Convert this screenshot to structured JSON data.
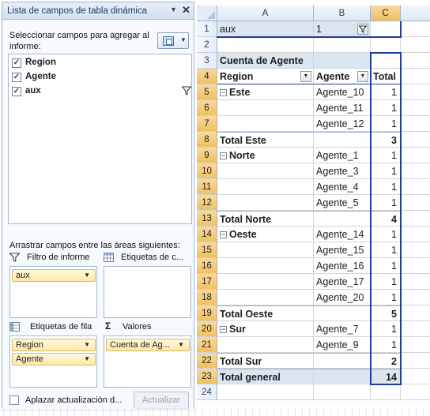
{
  "pane": {
    "title": "Lista de campos de tabla dinámica",
    "close_glyph": "✕",
    "dropdown_glyph": "▼",
    "choose_label": "Seleccionar campos para agregar al informe:",
    "layout_icon": "field-list-layout-icon",
    "fields": [
      {
        "label": "Region",
        "checked": true
      },
      {
        "label": "Agente",
        "checked": true
      },
      {
        "label": "aux",
        "checked": true
      }
    ],
    "drag_label": "Arrastrar campos entre las áreas siguientes:",
    "areas": {
      "filter": {
        "label": "Filtro de informe",
        "items": [
          "aux"
        ]
      },
      "columns": {
        "label": "Etiquetas de c...",
        "items": []
      },
      "rows": {
        "label": "Etiquetas de fila",
        "items": [
          "Region",
          "Agente"
        ]
      },
      "values": {
        "label": "Valores",
        "items": [
          "Cuenta de Ag..."
        ]
      }
    },
    "values_symbol": "Σ",
    "defer_label": "Aplazar actualización d...",
    "update_button": "Actualizar",
    "colors": {
      "pill": "#fde9a8",
      "accent": "#1f3d9b"
    }
  },
  "sheet": {
    "columns": [
      "A",
      "B",
      "C"
    ],
    "rows": [
      {
        "n": "1",
        "a": "aux",
        "b": "1",
        "c": ""
      },
      {
        "n": "2",
        "a": "",
        "b": "",
        "c": ""
      },
      {
        "n": "3",
        "a": "Cuenta de Agente",
        "b": "",
        "c": ""
      },
      {
        "n": "4",
        "a": "Region",
        "b": "Agente",
        "c": "Total"
      },
      {
        "n": "5",
        "a": "Este",
        "b": "Agente_10",
        "c": "1"
      },
      {
        "n": "6",
        "a": "",
        "b": "Agente_11",
        "c": "1"
      },
      {
        "n": "7",
        "a": "",
        "b": "Agente_12",
        "c": "1"
      },
      {
        "n": "8",
        "a": "Total Este",
        "b": "",
        "c": "3"
      },
      {
        "n": "9",
        "a": "Norte",
        "b": "Agente_1",
        "c": "1"
      },
      {
        "n": "10",
        "a": "",
        "b": "Agente_3",
        "c": "1"
      },
      {
        "n": "11",
        "a": "",
        "b": "Agente_4",
        "c": "1"
      },
      {
        "n": "12",
        "a": "",
        "b": "Agente_5",
        "c": "1"
      },
      {
        "n": "13",
        "a": "Total Norte",
        "b": "",
        "c": "4"
      },
      {
        "n": "14",
        "a": "Oeste",
        "b": "Agente_14",
        "c": "1"
      },
      {
        "n": "15",
        "a": "",
        "b": "Agente_15",
        "c": "1"
      },
      {
        "n": "16",
        "a": "",
        "b": "Agente_16",
        "c": "1"
      },
      {
        "n": "17",
        "a": "",
        "b": "Agente_17",
        "c": "1"
      },
      {
        "n": "18",
        "a": "",
        "b": "Agente_20",
        "c": "1"
      },
      {
        "n": "19",
        "a": "Total Oeste",
        "b": "",
        "c": "5"
      },
      {
        "n": "20",
        "a": "Sur",
        "b": "Agente_7",
        "c": "1"
      },
      {
        "n": "21",
        "a": "",
        "b": "Agente_9",
        "c": "1"
      },
      {
        "n": "22",
        "a": "Total Sur",
        "b": "",
        "c": "2"
      },
      {
        "n": "23",
        "a": "Total general",
        "b": "",
        "c": "14"
      },
      {
        "n": "24",
        "a": "",
        "b": "",
        "c": ""
      }
    ],
    "expander_glyph": "−",
    "selected_column": "C"
  }
}
